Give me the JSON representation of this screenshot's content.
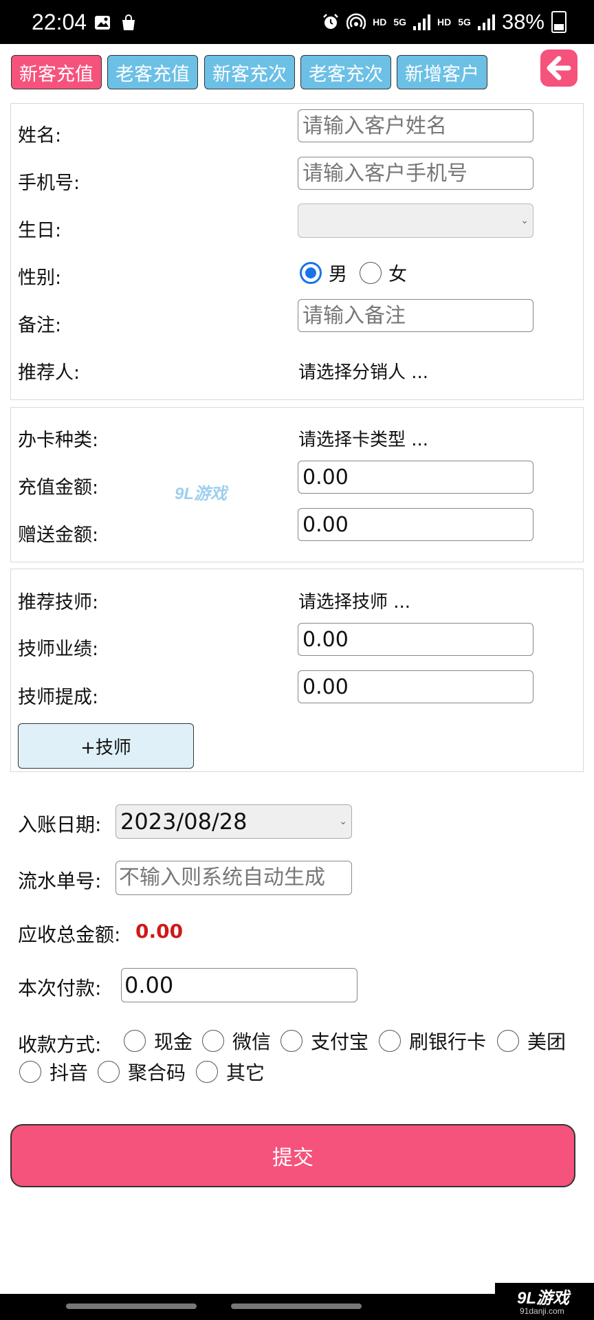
{
  "status_bar": {
    "time": "22:04",
    "battery": "38%",
    "net1": "5G",
    "net2": "5G",
    "hd1": "HD",
    "hd2": "HD"
  },
  "tabs": [
    {
      "label": "新客充值",
      "active": true
    },
    {
      "label": "老客充值",
      "active": false
    },
    {
      "label": "新客充次",
      "active": false
    },
    {
      "label": "老客充次",
      "active": false
    },
    {
      "label": "新增客户",
      "active": false
    }
  ],
  "customer": {
    "name_label": "姓名:",
    "name_placeholder": "请输入客户姓名",
    "phone_label": "手机号:",
    "phone_placeholder": "请输入客户手机号",
    "birthday_label": "生日:",
    "gender_label": "性别:",
    "gender_male": "男",
    "gender_female": "女",
    "gender_selected": "男",
    "remark_label": "备注:",
    "remark_placeholder": "请输入备注",
    "referrer_label": "推荐人:",
    "referrer_value": "请选择分销人 ..."
  },
  "card": {
    "type_label": "办卡种类:",
    "type_value": "请选择卡类型 ...",
    "recharge_label": "充值金额:",
    "recharge_value": "0.00",
    "gift_label": "赠送金额:",
    "gift_value": "0.00"
  },
  "technician": {
    "tech_label": "推荐技师:",
    "tech_value": "请选择技师 ...",
    "perf_label": "技师业绩:",
    "perf_value": "0.00",
    "commission_label": "技师提成:",
    "commission_value": "0.00",
    "add_button": "+技师"
  },
  "payment": {
    "date_label": "入账日期:",
    "date_value": "2023/08/28",
    "serial_label": "流水单号:",
    "serial_placeholder": "不输入则系统自动生成",
    "total_label": "应收总金额:",
    "total_value": "0.00",
    "pay_label": "本次付款:",
    "pay_value": "0.00",
    "method_label": "收款方式:",
    "methods": [
      "现金",
      "微信",
      "支付宝",
      "刷银行卡",
      "美团",
      "抖音",
      "聚合码",
      "其它"
    ]
  },
  "submit_label": "提交",
  "watermark": {
    "brand": "9L游戏",
    "domain": "91danji.com"
  },
  "colors": {
    "accent": "#f5527c",
    "tab_blue": "#6cc0e6",
    "radio_blue": "#1a73e8",
    "amount_red": "#d01818"
  }
}
